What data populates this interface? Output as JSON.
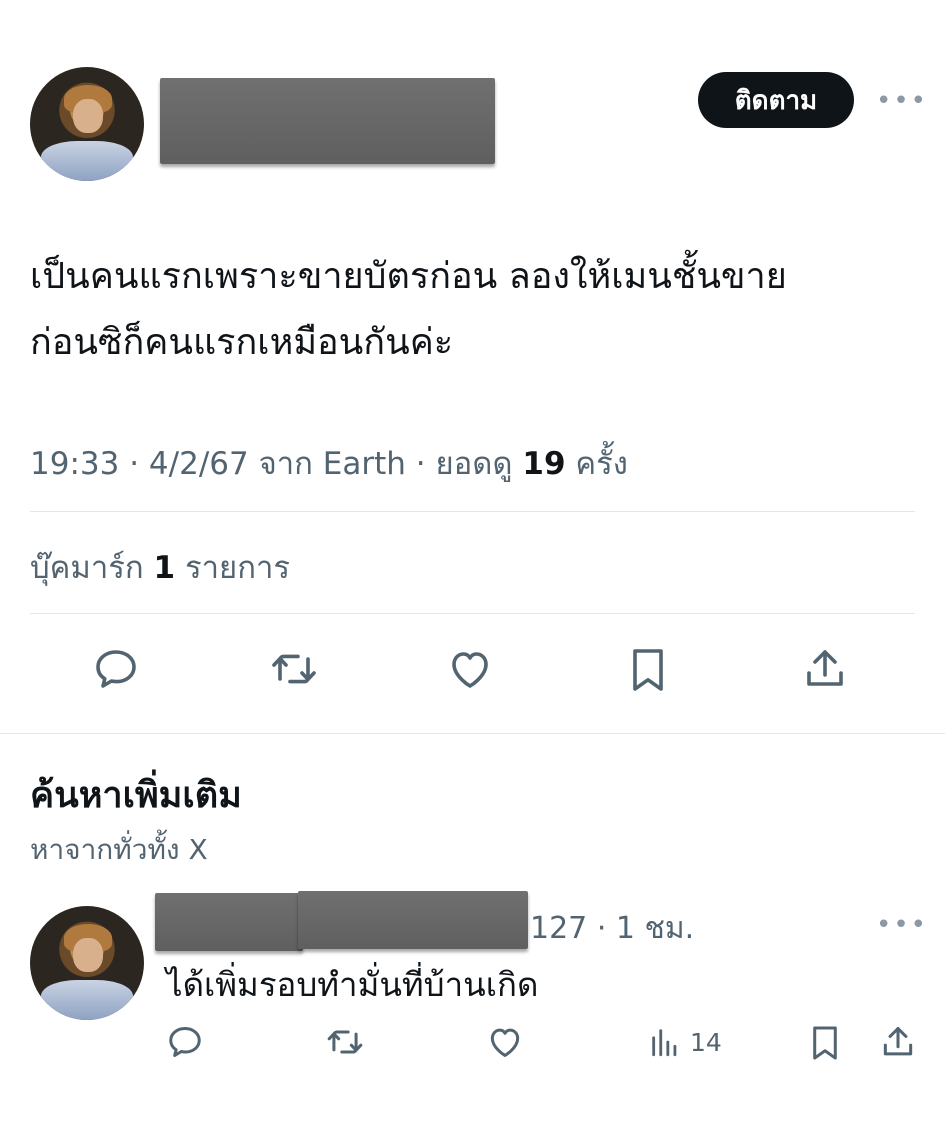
{
  "tweet": {
    "follow_label": "ติดตาม",
    "more_label": "•••",
    "text_line1": "เป็นคนแรกเพราะขายบัตรก่อน ลองให้เมนชั้นขาย",
    "text_line2": "ก่อนซิก็คนแรกเหมือนกันค่ะ",
    "meta": {
      "time": "19:33",
      "sep1": "·",
      "date": "4/2/67",
      "source_prefix": "จาก",
      "source": "Earth",
      "sep2": "·",
      "views_prefix": "ยอดดู",
      "views_count": "19",
      "views_suffix": "ครั้ง"
    },
    "bookmarks": {
      "prefix": "บุ๊คมาร์ก",
      "count": "1",
      "suffix": "รายการ"
    },
    "actions": [
      "reply-icon",
      "retweet-icon",
      "like-icon",
      "bookmark-icon",
      "share-icon"
    ]
  },
  "discover": {
    "title": "ค้นหาเพิ่มเติม",
    "subtitle": "หาจากทั่วทั้ง X"
  },
  "reply": {
    "handle_tail": "127",
    "sep": "·",
    "time": "1 ชม.",
    "more_label": "•••",
    "text": "ได้เพิ่มรอบทำมั่นที่บ้านเกิด",
    "views": "14"
  },
  "colors": {
    "text": "#0f1419",
    "secondary": "#536471",
    "divider": "#e3e7ea",
    "button_bg": "#0f1419"
  }
}
